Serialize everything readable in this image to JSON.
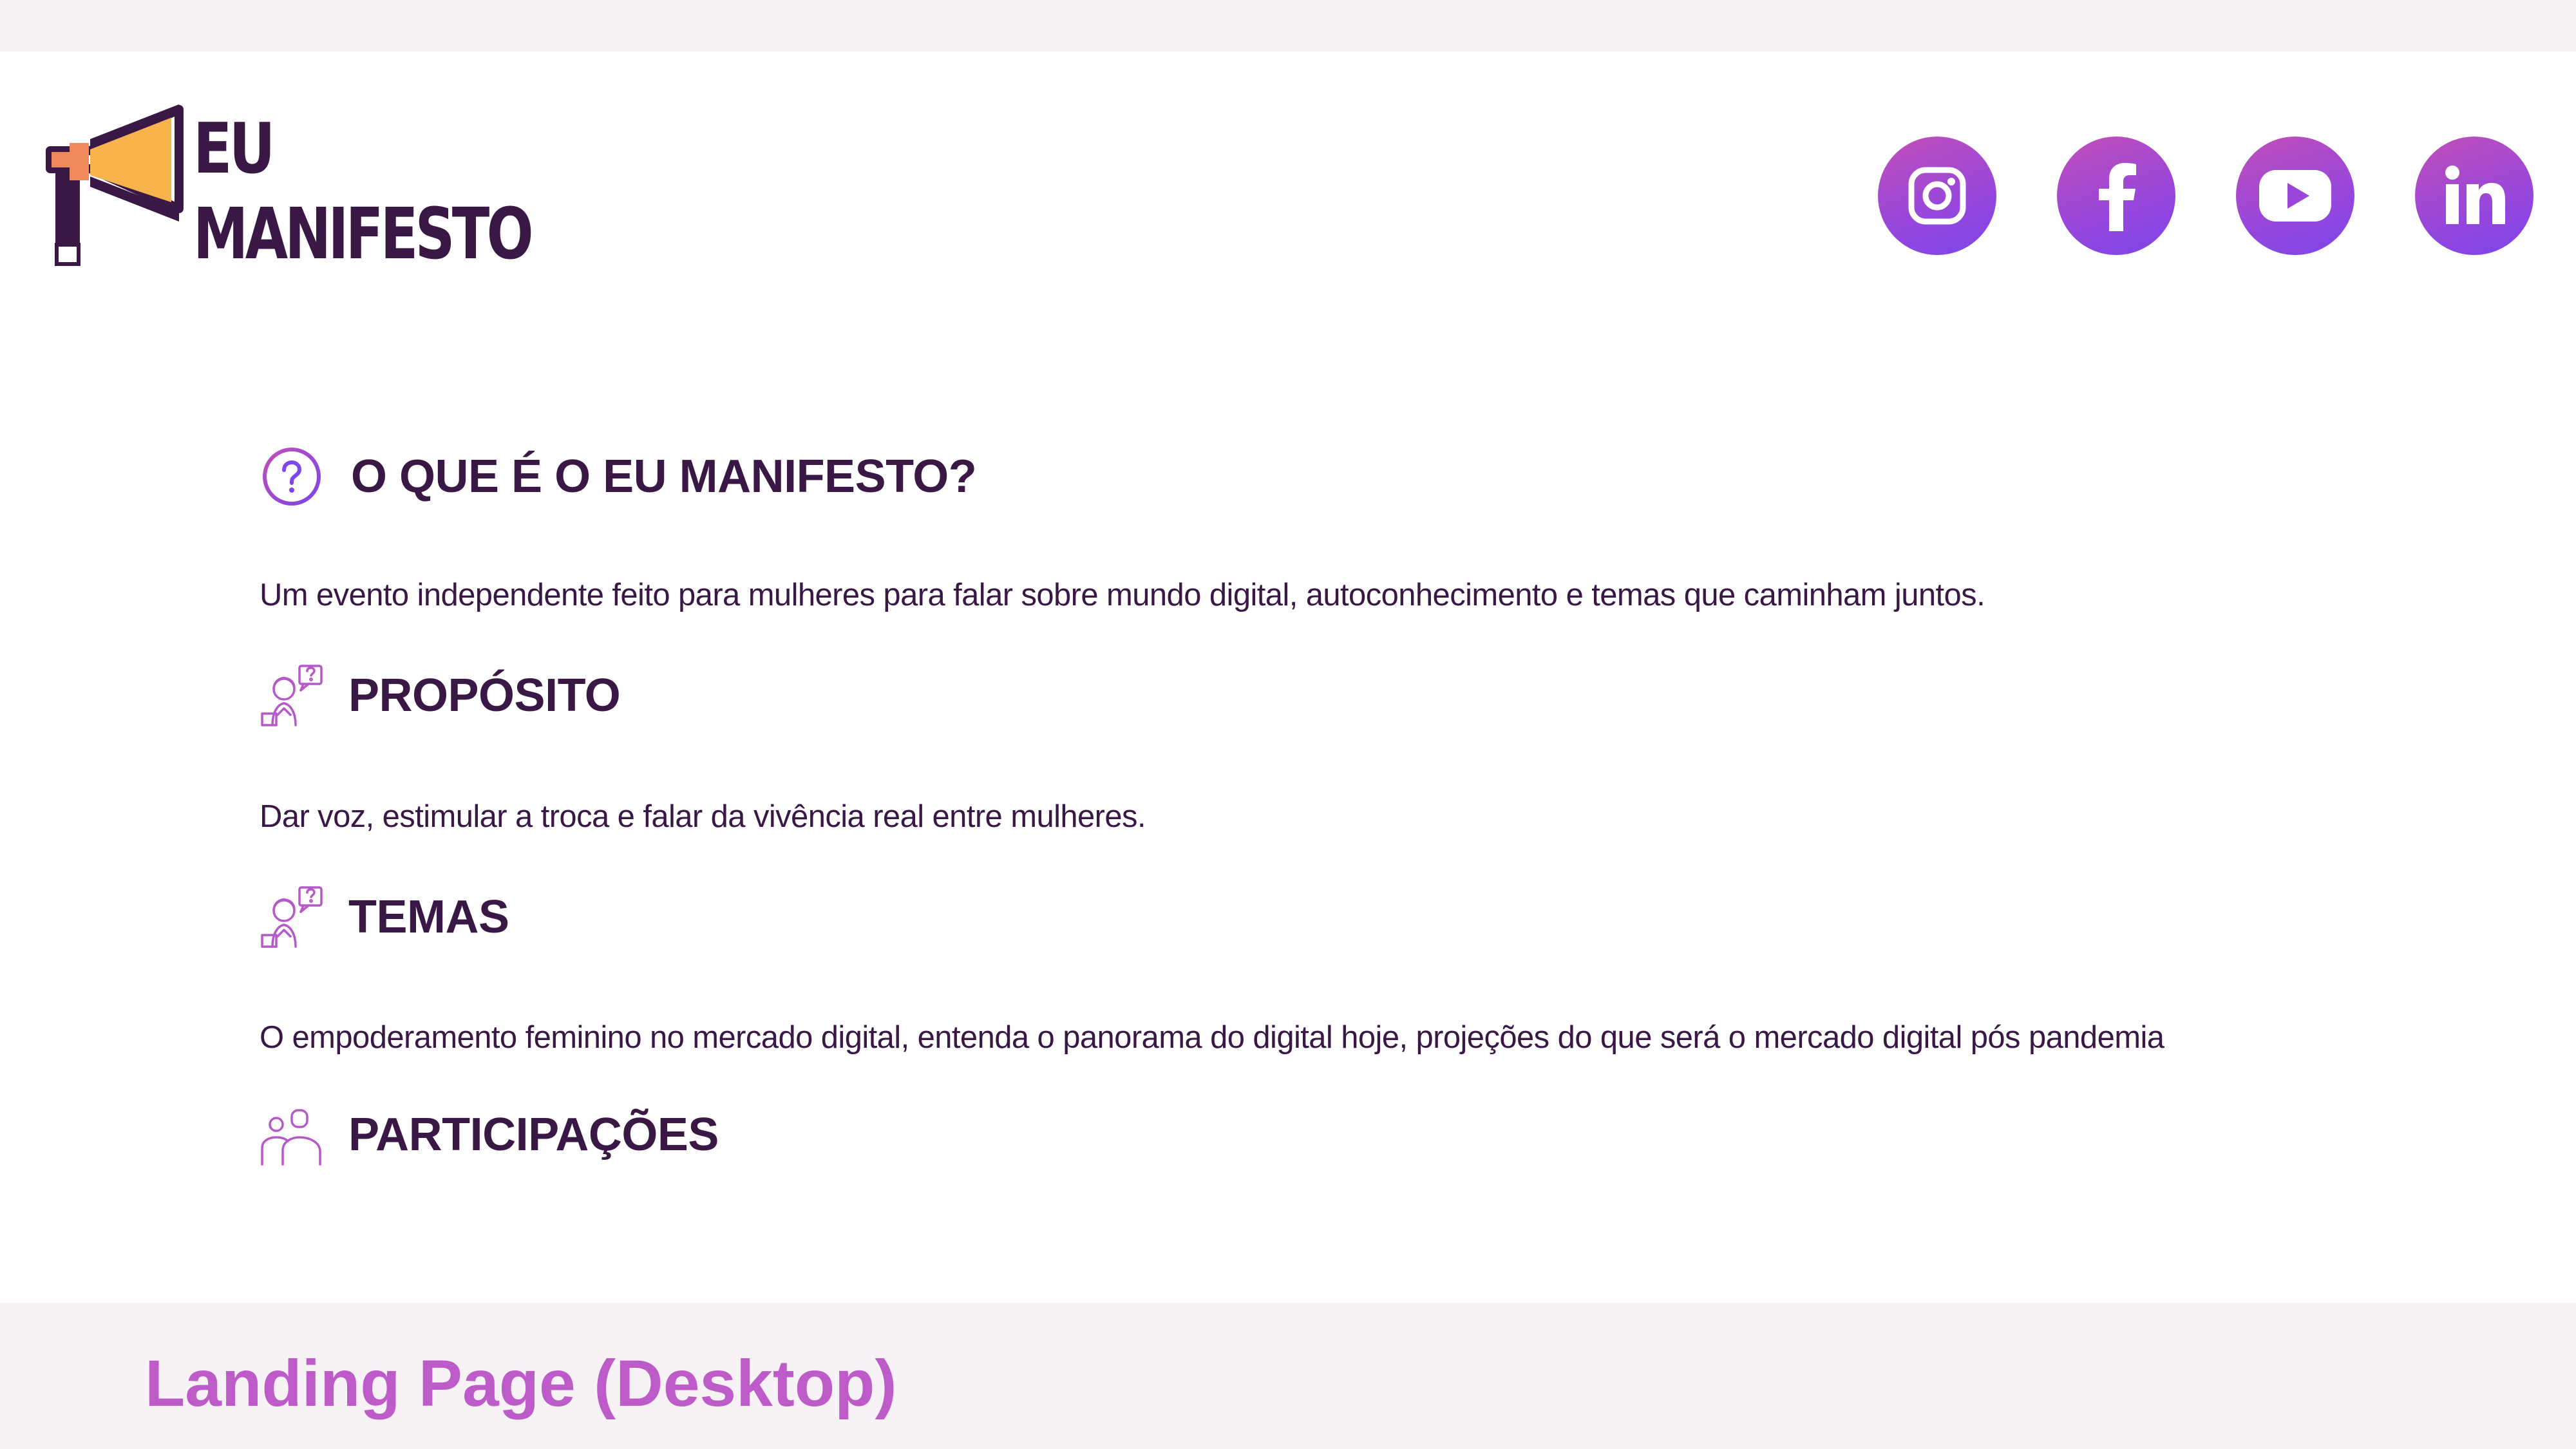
{
  "logo": {
    "line1": "EU",
    "line2": "MANIFESTO"
  },
  "social": [
    {
      "name": "instagram",
      "icon": "instagram-icon"
    },
    {
      "name": "facebook",
      "icon": "facebook-icon"
    },
    {
      "name": "youtube",
      "icon": "youtube-icon"
    },
    {
      "name": "linkedin",
      "icon": "linkedin-icon"
    }
  ],
  "sections": {
    "about": {
      "icon": "question-circle-icon",
      "title": "O QUE É O EU MANIFESTO?",
      "text": "Um evento independente feito para mulheres para falar sobre mundo digital, autoconhecimento e temas que caminham juntos."
    },
    "purpose": {
      "icon": "thinking-person-icon",
      "title": "PROPÓSITO",
      "text": "Dar voz, estimular a troca e falar da vivência real entre mulheres."
    },
    "themes": {
      "icon": "thinking-person-icon",
      "title": "TEMAS",
      "text": "O empoderamento feminino no mercado digital, entenda o panorama do digital hoje, projeções do que será o mercado digital pós pandemia"
    },
    "participants": {
      "icon": "people-icon",
      "title": "PARTICIPAÇÕES"
    }
  },
  "caption": "Landing Page (Desktop)",
  "colors": {
    "brand_dark": "#3a1846",
    "accent_pink": "#c14fb8",
    "accent_purple": "#7d45ea",
    "megaphone_orange": "#f08a5d",
    "megaphone_yellow": "#f7b34c",
    "caption": "#bd5bc9",
    "background": "#f7f2f6"
  }
}
